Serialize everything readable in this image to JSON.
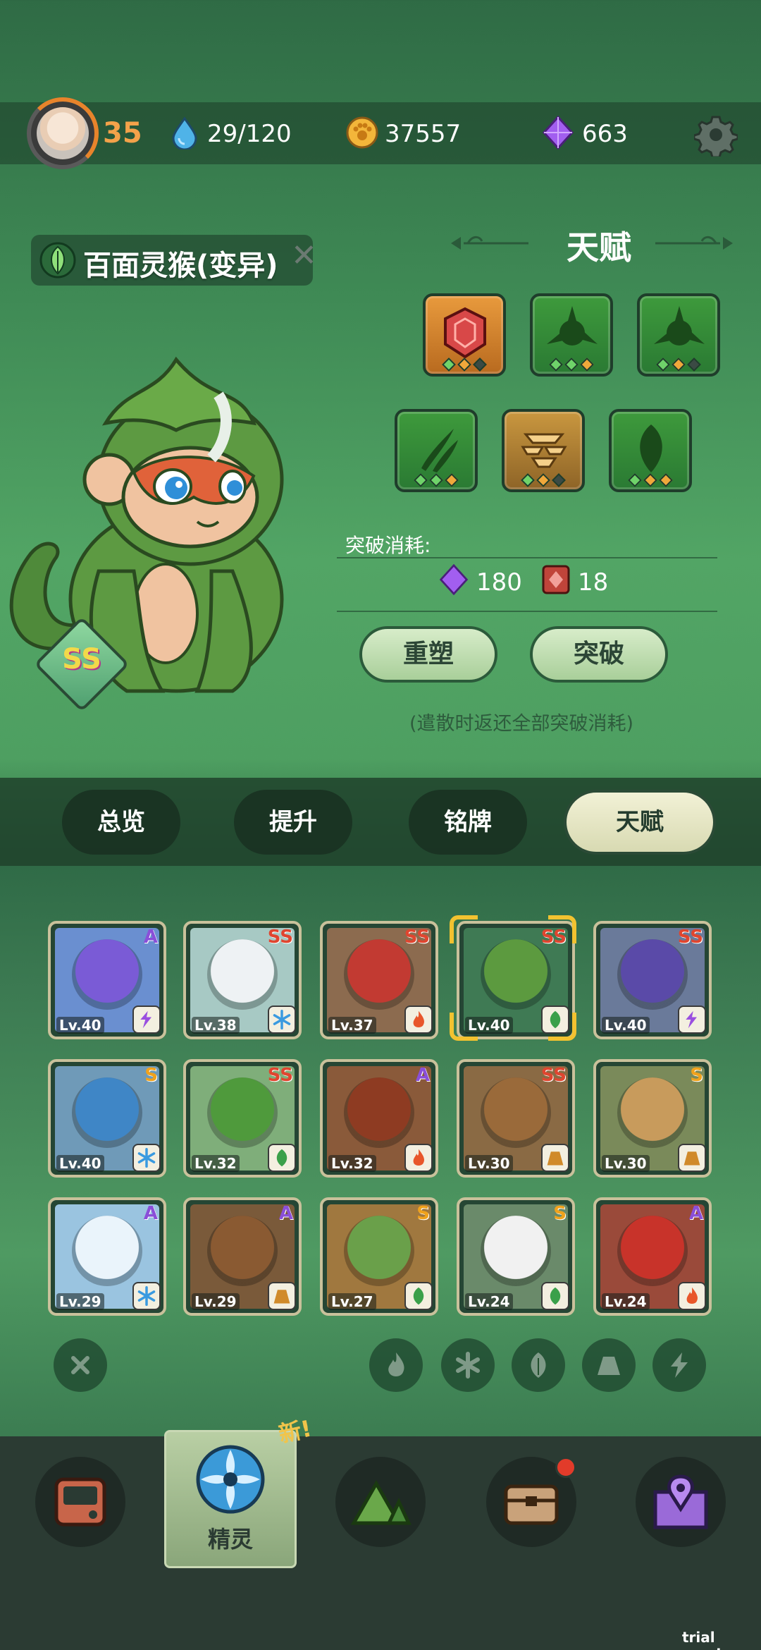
{
  "player": {
    "level": "35",
    "energy": "29/120",
    "coins": "37557",
    "gems": "663"
  },
  "pet": {
    "name": "百面灵猴(变异)",
    "rank": "SS"
  },
  "talent": {
    "title": "天赋",
    "cost_label": "突破消耗:",
    "cost_gems": "180",
    "cost_items": "18",
    "reshape_button": "重塑",
    "breakthrough_button": "突破",
    "note": "(遣散时返还全部突破消耗)"
  },
  "tabs": [
    "总览",
    "提升",
    "铭牌",
    "天赋"
  ],
  "pets": [
    {
      "rank": "A",
      "level": "Lv.40",
      "element": "lightning",
      "bg": "#6a8fd0",
      "color": "#7a5bd6"
    },
    {
      "rank": "SS",
      "level": "Lv.38",
      "element": "ice",
      "bg": "#a7c9c4",
      "color": "#eef2f4"
    },
    {
      "rank": "SS",
      "level": "Lv.37",
      "element": "fire",
      "bg": "#8c6b4f",
      "color": "#c23a32"
    },
    {
      "rank": "SS",
      "level": "Lv.40",
      "element": "leaf",
      "bg": "#3f7a54",
      "color": "#5c9a3f"
    },
    {
      "rank": "SS",
      "level": "Lv.40",
      "element": "lightning",
      "bg": "#6a7a9a",
      "color": "#5a4aa8"
    },
    {
      "rank": "S",
      "level": "Lv.40",
      "element": "ice",
      "bg": "#6f9ab8",
      "color": "#3f86c6"
    },
    {
      "rank": "SS",
      "level": "Lv.32",
      "element": "leaf",
      "bg": "#7fae7a",
      "color": "#4f9a3c"
    },
    {
      "rank": "A",
      "level": "Lv.32",
      "element": "fire",
      "bg": "#8a5a3a",
      "color": "#8e3b22"
    },
    {
      "rank": "SS",
      "level": "Lv.30",
      "element": "rock",
      "bg": "#8a6a44",
      "color": "#9a6a3a"
    },
    {
      "rank": "S",
      "level": "Lv.30",
      "element": "rock",
      "bg": "#7a8a5a",
      "color": "#c89b5c"
    },
    {
      "rank": "A",
      "level": "Lv.29",
      "element": "ice",
      "bg": "#9ac4e0",
      "color": "#eaf4fb"
    },
    {
      "rank": "A",
      "level": "Lv.29",
      "element": "rock",
      "bg": "#7a5a3a",
      "color": "#8a5a32"
    },
    {
      "rank": "S",
      "level": "Lv.27",
      "element": "leaf",
      "bg": "#a0783f",
      "color": "#6aa04a"
    },
    {
      "rank": "S",
      "level": "Lv.24",
      "element": "leaf",
      "bg": "#6a8a6a",
      "color": "#f1f1f1"
    },
    {
      "rank": "A",
      "level": "Lv.24",
      "element": "fire",
      "bg": "#9a4a3a",
      "color": "#c8332a"
    }
  ],
  "nav": {
    "active_label": "精灵",
    "new_badge": "新!"
  },
  "watermark": "trial version",
  "colors": {
    "rank_A": "#8a4fd8",
    "rank_S": "#f0a21c",
    "rank_SS": "#e0452f",
    "accent_orange": "#f3a24a"
  }
}
